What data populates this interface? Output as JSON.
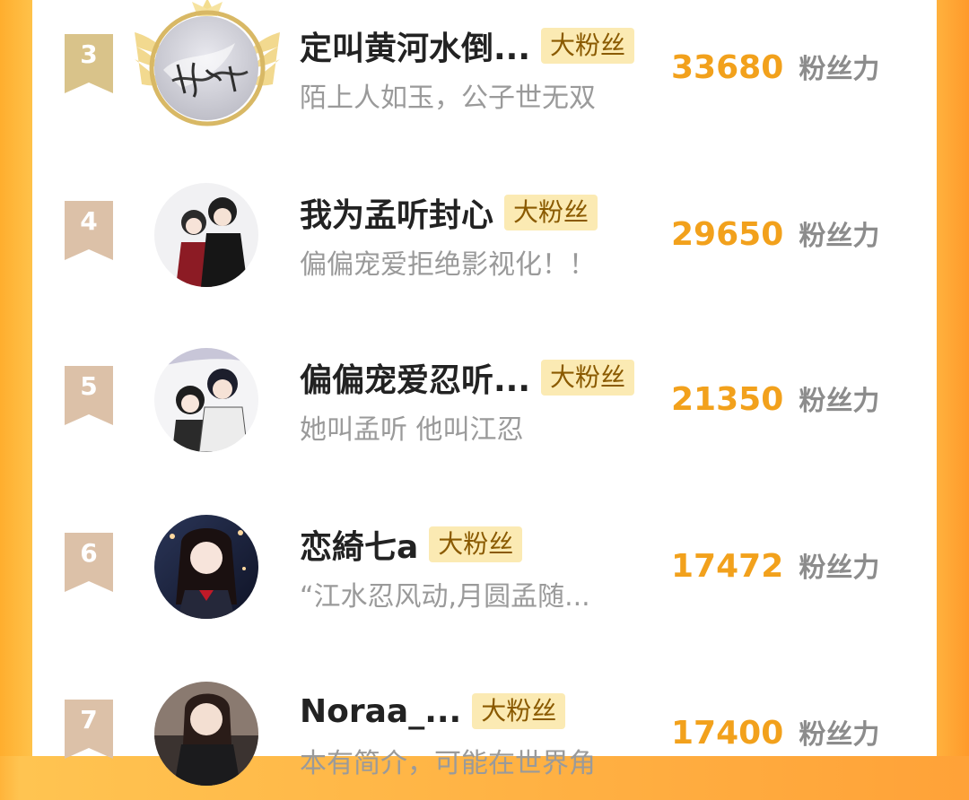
{
  "leaderboard": {
    "score_unit": "粉丝力",
    "entries": [
      {
        "rank": "3",
        "name": "定叫黄河水倒...",
        "badge": "大粉丝",
        "bio": "陌上人如玉，公子世无双",
        "score": "33680",
        "avatar_text": "抚琴的人",
        "rank_color": "#d9c38a"
      },
      {
        "rank": "4",
        "name": "我为孟听封心",
        "badge": "大粉丝",
        "bio": "偏偏宠爱拒绝影视化！！",
        "score": "29650",
        "avatar_text": "",
        "rank_color": "#dcc1a8"
      },
      {
        "rank": "5",
        "name": "偏偏宠爱忍听...",
        "badge": "大粉丝",
        "bio": "她叫孟听 他叫江忍",
        "score": "21350",
        "avatar_text": "",
        "rank_color": "#dcc1a8"
      },
      {
        "rank": "6",
        "name": "恋綺七a",
        "badge": "大粉丝",
        "bio": "“江水忍风动,月圆孟随...",
        "score": "17472",
        "avatar_text": "",
        "rank_color": "#dcc1a8"
      },
      {
        "rank": "7",
        "name": "Noraa_...",
        "badge": "大粉丝",
        "bio": "本有简介，可能在世界角",
        "score": "17400",
        "avatar_text": "",
        "rank_color": "#dcc1a8"
      }
    ]
  },
  "colors": {
    "frame_orange": "#ffa238",
    "score_gold": "#f2a11c",
    "badge_bg": "#fbeab3",
    "bio_gray": "#9a9a9a"
  }
}
